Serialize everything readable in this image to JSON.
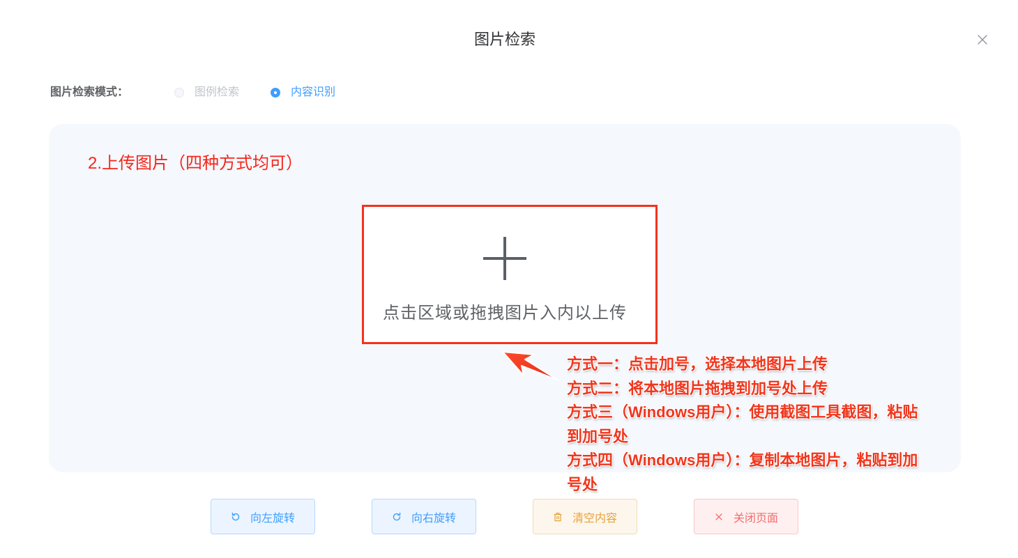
{
  "dialog": {
    "title": "图片检索",
    "close_icon": "close-icon"
  },
  "mode": {
    "label": "图片检索模式：",
    "options": [
      {
        "label": "图例检索",
        "selected": false,
        "disabled": true
      },
      {
        "label": "内容识别",
        "selected": true,
        "disabled": false
      }
    ]
  },
  "upload": {
    "step_heading": "2.上传图片（四种方式均可）",
    "plus_icon": "plus-icon",
    "hint": "点击区域或拖拽图片入内以上传"
  },
  "annotation": {
    "arrow_icon": "arrow-icon",
    "methods": [
      {
        "lines": [
          "方式一：点击加号，选择本地图片上传"
        ]
      },
      {
        "lines": [
          "方式二：将本地图片拖拽到加号处上传"
        ]
      },
      {
        "lines": [
          "方式三（Windows用户）：使用截图工具截图，粘贴",
          "到加号处"
        ]
      },
      {
        "lines": [
          "方式四（Windows用户）：复制本地图片，粘贴到加",
          "号处"
        ]
      }
    ]
  },
  "buttons": [
    {
      "label": "向左旋转",
      "icon": "rotate-left-icon"
    },
    {
      "label": "向右旋转",
      "icon": "rotate-right-icon"
    },
    {
      "label": "清空内容",
      "icon": "trash-icon"
    },
    {
      "label": "关闭页面",
      "icon": "close-icon"
    }
  ],
  "colors": {
    "primary": "#409eff",
    "warning": "#e6a23c",
    "danger": "#f56c6c",
    "annotation_red": "#f0361d",
    "heading_red": "#f5261b",
    "highlight_border": "#f5311c",
    "panel_bg": "#f5f8fc"
  }
}
